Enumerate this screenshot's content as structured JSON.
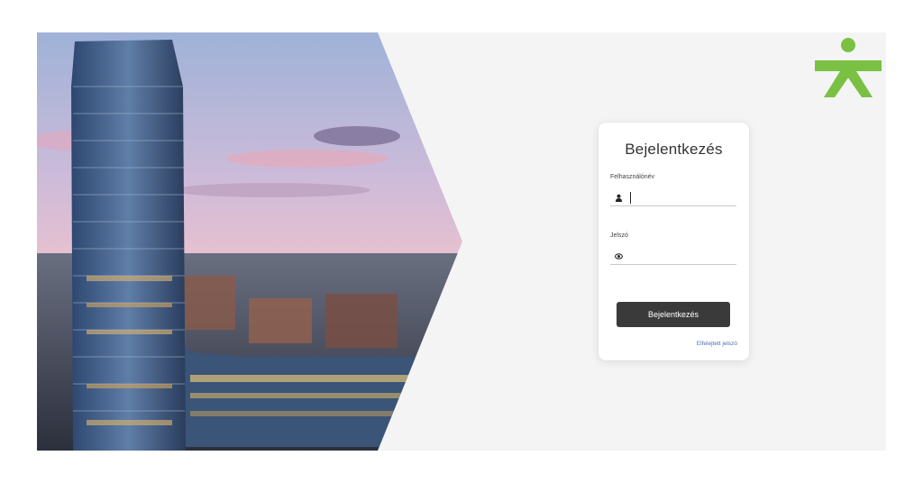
{
  "login": {
    "title": "Bejelentkezés",
    "username_label": "Felhasználónév",
    "username_value": "",
    "password_label": "Jelszó",
    "password_value": "",
    "submit_label": "Bejelentkezés",
    "forgot_password": "Elfelejtett jelszó"
  },
  "icons": {
    "username": "user-icon",
    "password": "eye-icon",
    "logo": "person-figure-logo"
  },
  "colors": {
    "brand_green": "#7ac143",
    "button_bg": "#3a3a3a",
    "link": "#4a6fb5",
    "panel_bg": "#f4f4f4"
  }
}
